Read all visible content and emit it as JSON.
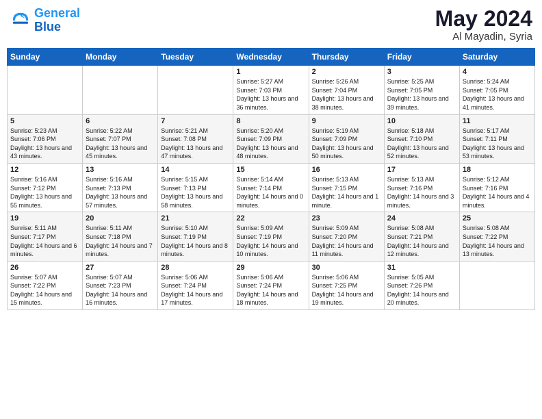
{
  "header": {
    "logo_line1": "General",
    "logo_line2": "Blue",
    "month": "May 2024",
    "location": "Al Mayadin, Syria"
  },
  "days_of_week": [
    "Sunday",
    "Monday",
    "Tuesday",
    "Wednesday",
    "Thursday",
    "Friday",
    "Saturday"
  ],
  "weeks": [
    [
      {
        "day": "",
        "sunrise": "",
        "sunset": "",
        "daylight": ""
      },
      {
        "day": "",
        "sunrise": "",
        "sunset": "",
        "daylight": ""
      },
      {
        "day": "",
        "sunrise": "",
        "sunset": "",
        "daylight": ""
      },
      {
        "day": "1",
        "sunrise": "5:27 AM",
        "sunset": "7:03 PM",
        "daylight": "13 hours and 36 minutes."
      },
      {
        "day": "2",
        "sunrise": "5:26 AM",
        "sunset": "7:04 PM",
        "daylight": "13 hours and 38 minutes."
      },
      {
        "day": "3",
        "sunrise": "5:25 AM",
        "sunset": "7:05 PM",
        "daylight": "13 hours and 39 minutes."
      },
      {
        "day": "4",
        "sunrise": "5:24 AM",
        "sunset": "7:05 PM",
        "daylight": "13 hours and 41 minutes."
      }
    ],
    [
      {
        "day": "5",
        "sunrise": "5:23 AM",
        "sunset": "7:06 PM",
        "daylight": "13 hours and 43 minutes."
      },
      {
        "day": "6",
        "sunrise": "5:22 AM",
        "sunset": "7:07 PM",
        "daylight": "13 hours and 45 minutes."
      },
      {
        "day": "7",
        "sunrise": "5:21 AM",
        "sunset": "7:08 PM",
        "daylight": "13 hours and 47 minutes."
      },
      {
        "day": "8",
        "sunrise": "5:20 AM",
        "sunset": "7:09 PM",
        "daylight": "13 hours and 48 minutes."
      },
      {
        "day": "9",
        "sunrise": "5:19 AM",
        "sunset": "7:09 PM",
        "daylight": "13 hours and 50 minutes."
      },
      {
        "day": "10",
        "sunrise": "5:18 AM",
        "sunset": "7:10 PM",
        "daylight": "13 hours and 52 minutes."
      },
      {
        "day": "11",
        "sunrise": "5:17 AM",
        "sunset": "7:11 PM",
        "daylight": "13 hours and 53 minutes."
      }
    ],
    [
      {
        "day": "12",
        "sunrise": "5:16 AM",
        "sunset": "7:12 PM",
        "daylight": "13 hours and 55 minutes."
      },
      {
        "day": "13",
        "sunrise": "5:16 AM",
        "sunset": "7:13 PM",
        "daylight": "13 hours and 57 minutes."
      },
      {
        "day": "14",
        "sunrise": "5:15 AM",
        "sunset": "7:13 PM",
        "daylight": "13 hours and 58 minutes."
      },
      {
        "day": "15",
        "sunrise": "5:14 AM",
        "sunset": "7:14 PM",
        "daylight": "14 hours and 0 minutes."
      },
      {
        "day": "16",
        "sunrise": "5:13 AM",
        "sunset": "7:15 PM",
        "daylight": "14 hours and 1 minute."
      },
      {
        "day": "17",
        "sunrise": "5:13 AM",
        "sunset": "7:16 PM",
        "daylight": "14 hours and 3 minutes."
      },
      {
        "day": "18",
        "sunrise": "5:12 AM",
        "sunset": "7:16 PM",
        "daylight": "14 hours and 4 minutes."
      }
    ],
    [
      {
        "day": "19",
        "sunrise": "5:11 AM",
        "sunset": "7:17 PM",
        "daylight": "14 hours and 6 minutes."
      },
      {
        "day": "20",
        "sunrise": "5:11 AM",
        "sunset": "7:18 PM",
        "daylight": "14 hours and 7 minutes."
      },
      {
        "day": "21",
        "sunrise": "5:10 AM",
        "sunset": "7:19 PM",
        "daylight": "14 hours and 8 minutes."
      },
      {
        "day": "22",
        "sunrise": "5:09 AM",
        "sunset": "7:19 PM",
        "daylight": "14 hours and 10 minutes."
      },
      {
        "day": "23",
        "sunrise": "5:09 AM",
        "sunset": "7:20 PM",
        "daylight": "14 hours and 11 minutes."
      },
      {
        "day": "24",
        "sunrise": "5:08 AM",
        "sunset": "7:21 PM",
        "daylight": "14 hours and 12 minutes."
      },
      {
        "day": "25",
        "sunrise": "5:08 AM",
        "sunset": "7:22 PM",
        "daylight": "14 hours and 13 minutes."
      }
    ],
    [
      {
        "day": "26",
        "sunrise": "5:07 AM",
        "sunset": "7:22 PM",
        "daylight": "14 hours and 15 minutes."
      },
      {
        "day": "27",
        "sunrise": "5:07 AM",
        "sunset": "7:23 PM",
        "daylight": "14 hours and 16 minutes."
      },
      {
        "day": "28",
        "sunrise": "5:06 AM",
        "sunset": "7:24 PM",
        "daylight": "14 hours and 17 minutes."
      },
      {
        "day": "29",
        "sunrise": "5:06 AM",
        "sunset": "7:24 PM",
        "daylight": "14 hours and 18 minutes."
      },
      {
        "day": "30",
        "sunrise": "5:06 AM",
        "sunset": "7:25 PM",
        "daylight": "14 hours and 19 minutes."
      },
      {
        "day": "31",
        "sunrise": "5:05 AM",
        "sunset": "7:26 PM",
        "daylight": "14 hours and 20 minutes."
      },
      {
        "day": "",
        "sunrise": "",
        "sunset": "",
        "daylight": ""
      }
    ]
  ]
}
